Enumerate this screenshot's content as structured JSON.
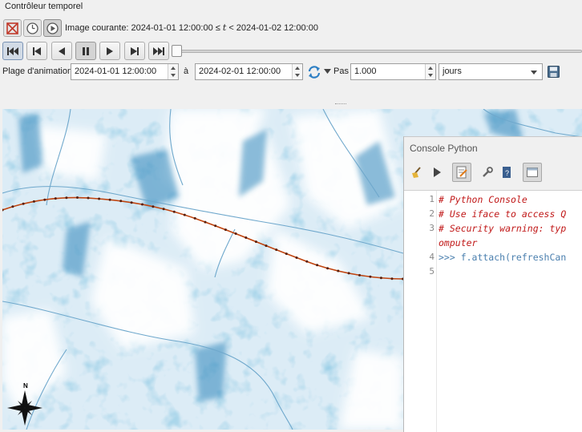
{
  "panel": {
    "title": "Contrôleur temporel",
    "current_frame_prefix": "Image courante: 2024-01-01 12:00:00 ≤ ",
    "current_frame_var": "t",
    "current_frame_suffix": " < 2024-01-02 12:00:00",
    "mode_buttons": [
      "disable-temporal-icon",
      "fixed-range-icon",
      "animated-icon"
    ],
    "nav_buttons": [
      "skip-to-start-icon",
      "previous-frame-icon",
      "play-backward-icon",
      "pause-icon",
      "play-forward-icon",
      "next-frame-icon",
      "skip-to-end-icon"
    ],
    "slider_position": 0
  },
  "range": {
    "label": "Plage d'animation",
    "start": "2024-01-01 12:00:00",
    "to_label": "à",
    "end": "2024-02-01 12:00:00",
    "step_label": "Pas",
    "step_value": "1.000",
    "unit": "jours"
  },
  "console": {
    "title": "Console Python",
    "lines": [
      {
        "num": "1",
        "text": "# Python Console",
        "cls": "comment"
      },
      {
        "num": "2",
        "text": "# Use iface to access Q",
        "cls": "comment"
      },
      {
        "num": "3",
        "text": "# Security warning: typ",
        "cls": "comment"
      },
      {
        "num": "",
        "text": "omputer",
        "cls": "comment"
      },
      {
        "num": "4",
        "text": ">>> f.attach(refreshCan",
        "cls": "prompt-code"
      },
      {
        "num": "5",
        "text": "",
        "cls": ""
      }
    ]
  },
  "map": {
    "north_label": "N"
  },
  "colors": {
    "track": "#c0440f",
    "river": "#6fa8cc",
    "snow": "#ffffff",
    "shade": "#2a7fb4"
  }
}
